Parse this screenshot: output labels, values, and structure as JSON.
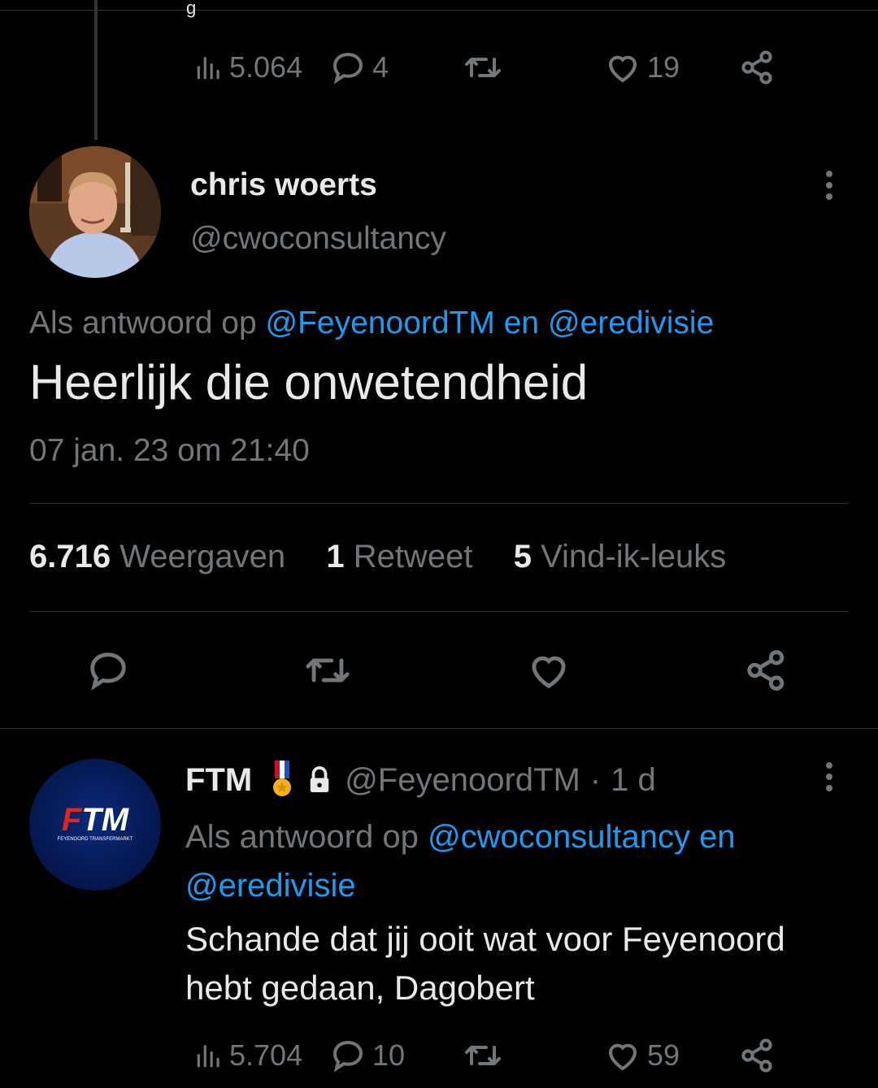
{
  "top_tweet": {
    "fragment_char": "g",
    "views": "5.064",
    "replies": "4",
    "likes": "19"
  },
  "main_tweet": {
    "display_name": "chris woerts",
    "handle": "@cwoconsultancy",
    "reply_prefix": "Als antwoord op",
    "reply_mention_1": "@FeyenoordTM",
    "reply_conj": "en",
    "reply_mention_2": "@eredivisie",
    "text": "Heerlijk die onwetendheid",
    "timestamp": "07 jan. 23 om 21:40",
    "stats": {
      "views_count": "6.716",
      "views_label": "Weergaven",
      "retweets_count": "1",
      "retweets_label": "Retweet",
      "likes_count": "5",
      "likes_label": "Vind-ik-leuks"
    }
  },
  "reply_tweet": {
    "display_name": "FTM",
    "handle": "@FeyenoordTM",
    "separator": "·",
    "time_ago": "1 d",
    "reply_prefix": "Als antwoord op",
    "reply_mention_1": "@cwoconsultancy",
    "reply_conj": "en",
    "reply_mention_2": "@eredivisie",
    "text": "Schande dat jij ooit wat voor Feyenoord hebt gedaan, Dagobert",
    "views": "5.704",
    "replies": "10",
    "likes": "59",
    "logo_text": "FTM",
    "logo_subtext": "FEYENOORD TRANSFERMARKT"
  },
  "colors": {
    "background": "#000000",
    "text": "#e7e9ea",
    "muted": "#71767b",
    "link": "#1d9bf0",
    "divider": "#2f3336"
  }
}
